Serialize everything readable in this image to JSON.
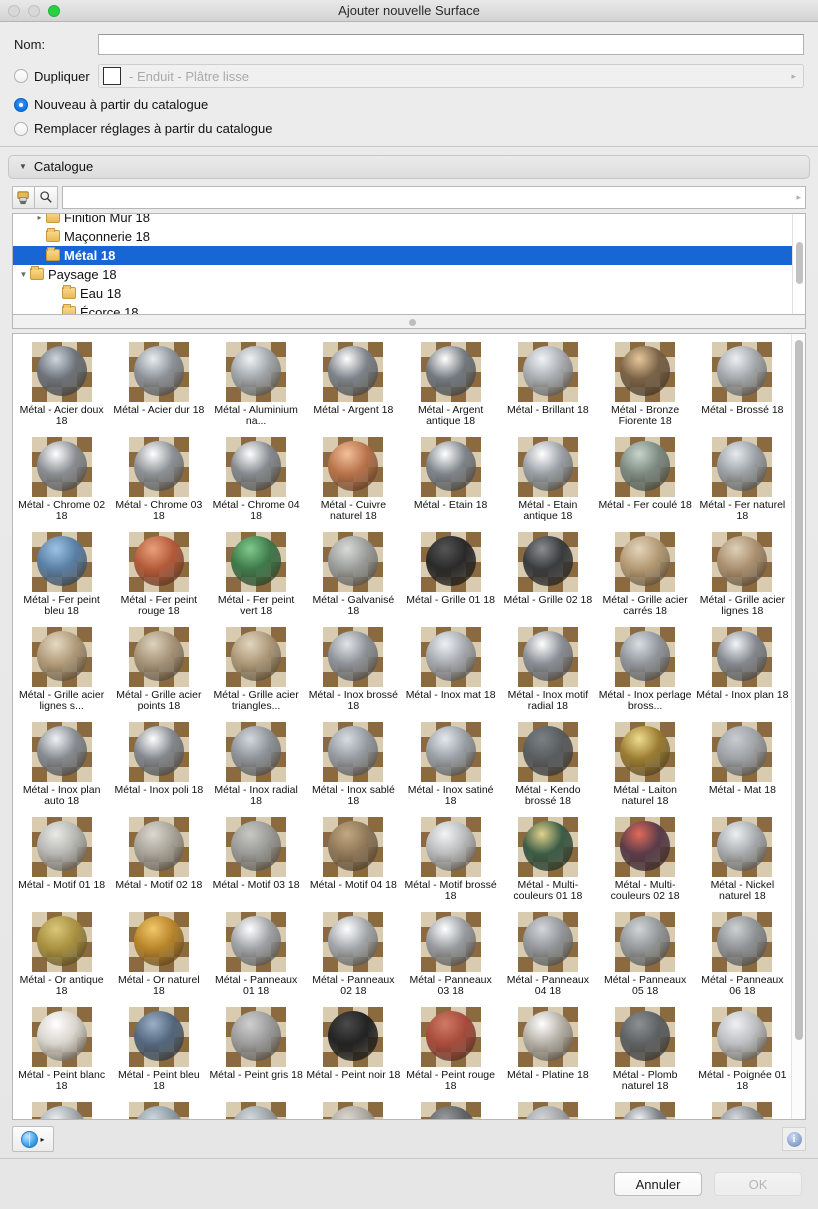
{
  "window": {
    "title": "Ajouter nouvelle Surface",
    "traffic": [
      "close",
      "minimize",
      "zoom"
    ]
  },
  "form": {
    "name_label": "Nom:",
    "name_value": "",
    "name_placeholder": "",
    "options": [
      {
        "label": "Dupliquer",
        "selected": false
      },
      {
        "label": "Nouveau à partir du catalogue",
        "selected": true
      },
      {
        "label": "Remplacer réglages à partir du catalogue",
        "selected": false
      }
    ],
    "duplicate_combo": {
      "value": "- Enduit - Plâtre lisse",
      "swatch_color": "#ffffff",
      "arrow": "▸"
    }
  },
  "catalogue": {
    "header_label": "Catalogue",
    "disclosure": "▼",
    "toolbar": {
      "brush_icon": "paint-brush-icon",
      "search_icon": "🔍",
      "search_value": "",
      "search_placeholder": "",
      "arrow": "▸"
    },
    "tree": [
      {
        "label": "Finition Mur 18",
        "indent": 1,
        "twisty": "▸",
        "selected": false,
        "clipped": true
      },
      {
        "label": "Maçonnerie 18",
        "indent": 1,
        "twisty": "",
        "selected": false
      },
      {
        "label": "Métal 18",
        "indent": 1,
        "twisty": "",
        "selected": true
      },
      {
        "label": "Paysage 18",
        "indent": 0,
        "twisty": "▼",
        "selected": false
      },
      {
        "label": "Eau 18",
        "indent": 2,
        "twisty": "",
        "selected": false
      },
      {
        "label": "Écorce 18",
        "indent": 2,
        "twisty": "",
        "selected": false,
        "clipped": true
      }
    ]
  },
  "materials": [
    {
      "name": "Métal - Acier doux 18",
      "color": "#6e737a",
      "hi": "#cfd6dd"
    },
    {
      "name": "Métal - Acier dur 18",
      "color": "#8d9298",
      "hi": "#e8edf2"
    },
    {
      "name": "Métal - Aluminium na...",
      "color": "#a0a5a9",
      "hi": "#eef2f5"
    },
    {
      "name": "Métal - Argent 18",
      "color": "#7d838a",
      "hi": "#ffffff"
    },
    {
      "name": "Métal - Argent antique 18",
      "color": "#73797f",
      "hi": "#ffffff"
    },
    {
      "name": "Métal - Brillant 18",
      "color": "#a9adb1",
      "hi": "#f0f3f6"
    },
    {
      "name": "Métal - Bronze Fiorente 18",
      "color": "#7a6247",
      "hi": "#e6c79a"
    },
    {
      "name": "Métal - Brossé 18",
      "color": "#a3a7ab",
      "hi": "#eceff2"
    },
    {
      "name": "Métal - Chrome 02 18",
      "color": "#8a8e93",
      "hi": "#ffffff"
    },
    {
      "name": "Métal - Chrome 03 18",
      "color": "#8d9196",
      "hi": "#ffffff"
    },
    {
      "name": "Métal - Chrome 04 18",
      "color": "#868a90",
      "hi": "#ffffff"
    },
    {
      "name": "Métal - Cuivre naturel 18",
      "color": "#b8724a",
      "hi": "#f2c09b"
    },
    {
      "name": "Métal - Etain 18",
      "color": "#7f858b",
      "hi": "#ffffff"
    },
    {
      "name": "Métal - Etain antique 18",
      "color": "#9aa0a6",
      "hi": "#ffffff"
    },
    {
      "name": "Métal - Fer coulé 18",
      "color": "#7c8a82",
      "hi": "#c7d4cc"
    },
    {
      "name": "Métal - Fer naturel 18",
      "color": "#9ca1a6",
      "hi": "#e7ebef"
    },
    {
      "name": "Métal - Fer peint bleu 18",
      "color": "#5a7fa5",
      "hi": "#9dc3e4"
    },
    {
      "name": "Métal - Fer peint rouge 18",
      "color": "#b45a3a",
      "hi": "#e9a07a"
    },
    {
      "name": "Métal - Fer peint vert 18",
      "color": "#3f7a4a",
      "hi": "#7fc98c"
    },
    {
      "name": "Métal - Galvanisé 18",
      "color": "#9b9d9b",
      "hi": "#d9dbd9"
    },
    {
      "name": "Métal - Grille 01 18",
      "color": "#2a2a2a",
      "hi": "#555555"
    },
    {
      "name": "Métal - Grille 02 18",
      "color": "#3a3c3e",
      "hi": "#8a8d90"
    },
    {
      "name": "Métal - Grille acier carrés 18",
      "color": "#b49a74",
      "hi": "#e3d4bc"
    },
    {
      "name": "Métal - Grille acier lignes 18",
      "color": "#ab9070",
      "hi": "#ded0b8"
    },
    {
      "name": "Métal - Grille acier lignes s...",
      "color": "#b09a7a",
      "hi": "#e6dac4"
    },
    {
      "name": "Métal - Grille acier points 18",
      "color": "#a69378",
      "hi": "#ded2bd"
    },
    {
      "name": "Métal - Grille acier triangles...",
      "color": "#ac9878",
      "hi": "#e2d6c0"
    },
    {
      "name": "Métal - Inox brossé 18",
      "color": "#8e9298",
      "hi": "#e2e6ea"
    },
    {
      "name": "Métal - Inox mat 18",
      "color": "#a6aab0",
      "hi": "#eef1f4"
    },
    {
      "name": "Métal - Inox motif radial 18",
      "color": "#8a8f96",
      "hi": "#ffffff"
    },
    {
      "name": "Métal - Inox perlage bross...",
      "color": "#91969c",
      "hi": "#d9dee3"
    },
    {
      "name": "Métal - Inox plan 18",
      "color": "#84898f",
      "hi": "#f2f5f8"
    },
    {
      "name": "Métal - Inox plan auto 18",
      "color": "#868b91",
      "hi": "#f0f3f6"
    },
    {
      "name": "Métal - Inox poli 18",
      "color": "#83888e",
      "hi": "#ffffff"
    },
    {
      "name": "Métal - Inox radial 18",
      "color": "#8e9399",
      "hi": "#d4d9de"
    },
    {
      "name": "Métal - Inox sablé 18",
      "color": "#969ba1",
      "hi": "#d8dde2"
    },
    {
      "name": "Métal - Inox satiné 18",
      "color": "#9aa0a6",
      "hi": "#e4e9ee"
    },
    {
      "name": "Métal - Kendo brossé 18",
      "color": "#595d60",
      "hi": "#7b8084"
    },
    {
      "name": "Métal - Laiton naturel 18",
      "color": "#9a7c32",
      "hi": "#f0dc8e"
    },
    {
      "name": "Métal - Mat 18",
      "color": "#9ea2a6",
      "hi": "#c9cdd1"
    },
    {
      "name": "Métal - Motif 01 18",
      "color": "#b6b6b2",
      "hi": "#e9e9e6"
    },
    {
      "name": "Métal - Motif 02 18",
      "color": "#a9a49a",
      "hi": "#ddd8cf"
    },
    {
      "name": "Métal - Motif 03 18",
      "color": "#9a9a96",
      "hi": "#c8c8c4"
    },
    {
      "name": "Métal - Motif 04 18",
      "color": "#8f7758",
      "hi": "#c2a882"
    },
    {
      "name": "Métal - Motif brossé 18",
      "color": "#b9bbbd",
      "hi": "#f2f4f6"
    },
    {
      "name": "Métal - Multi-couleurs 01 18",
      "color": "#3c5c46",
      "hi": "#e0d38c"
    },
    {
      "name": "Métal - Multi-couleurs 02 18",
      "color": "#5a3c4a",
      "hi": "#e06a5a"
    },
    {
      "name": "Métal - Nickel naturel 18",
      "color": "#a8acaf",
      "hi": "#ecf0f3"
    },
    {
      "name": "Métal - Or antique 18",
      "color": "#a8913f",
      "hi": "#d8c77a"
    },
    {
      "name": "Métal - Or naturel 18",
      "color": "#b8842a",
      "hi": "#f2c76a"
    },
    {
      "name": "Métal - Panneaux 01 18",
      "color": "#9fa3a7",
      "hi": "#ffffff"
    },
    {
      "name": "Métal - Panneaux 02 18",
      "color": "#a3a7ab",
      "hi": "#ffffff"
    },
    {
      "name": "Métal - Panneaux 03 18",
      "color": "#989ca0",
      "hi": "#ffffff"
    },
    {
      "name": "Métal - Panneaux 04 18",
      "color": "#93979b",
      "hi": "#d3d7db"
    },
    {
      "name": "Métal - Panneaux 05 18",
      "color": "#949899",
      "hi": "#d0d4d6"
    },
    {
      "name": "Métal - Panneaux 06 18",
      "color": "#8f9396",
      "hi": "#cdd1d4"
    },
    {
      "name": "Métal - Peint blanc 18",
      "color": "#d8d4cc",
      "hi": "#ffffff"
    },
    {
      "name": "Métal - Peint bleu 18",
      "color": "#53677e",
      "hi": "#9bb0c6"
    },
    {
      "name": "Métal - Peint gris 18",
      "color": "#9c9c9c",
      "hi": "#cfcfcf"
    },
    {
      "name": "Métal - Peint noir 18",
      "color": "#232323",
      "hi": "#4a4a4a"
    },
    {
      "name": "Métal - Peint rouge 18",
      "color": "#a84b3c",
      "hi": "#cf7a66"
    },
    {
      "name": "Métal - Platine 18",
      "color": "#b5b0a6",
      "hi": "#ffffff"
    },
    {
      "name": "Métal - Plomb naturel 18",
      "color": "#5e6163",
      "hi": "#8d9092"
    },
    {
      "name": "Métal - Poignée 01 18",
      "color": "#bcbfc1",
      "hi": "#eef0f2"
    },
    {
      "name": "",
      "color": "#a0a5a9",
      "hi": "#e9edf0",
      "partial": true
    },
    {
      "name": "",
      "color": "#8e9ba4",
      "hi": "#cdd8e0",
      "partial": true
    },
    {
      "name": "",
      "color": "#9aa0a4",
      "hi": "#d6dbdf",
      "partial": true
    },
    {
      "name": "",
      "color": "#a8a49c",
      "hi": "#ddd9d2",
      "partial": true
    },
    {
      "name": "",
      "color": "#5f6265",
      "hi": "#9a9da0",
      "partial": true
    },
    {
      "name": "",
      "color": "#9fa3a6",
      "hi": "#d2d6d9",
      "partial": true
    },
    {
      "name": "",
      "color": "#7b8086",
      "hi": "#f0f3f6",
      "partial": true
    },
    {
      "name": "",
      "color": "#868b8f",
      "hi": "#d9dde1",
      "partial": true
    }
  ],
  "bottom": {
    "globe_label": "globe-dropdown",
    "globe_arrow": "▸",
    "info_label": "i"
  },
  "actions": {
    "cancel_label": "Annuler",
    "ok_label": "OK"
  }
}
